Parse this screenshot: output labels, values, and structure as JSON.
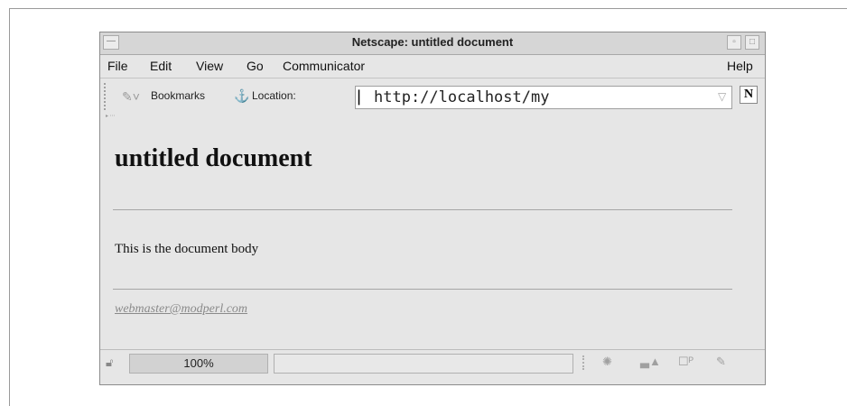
{
  "window": {
    "title": "Netscape: untitled document",
    "minimize_glyph": "—",
    "restore_glyph": "▫",
    "close_glyph": "□"
  },
  "menubar": {
    "items": [
      "File",
      "Edit",
      "View",
      "Go",
      "Communicator"
    ],
    "help": "Help"
  },
  "toolbar": {
    "bookmarks_label": "Bookmarks",
    "location_label": "Location:",
    "url": "http://localhost/my",
    "bookmarks_icon": "bookmark-icon",
    "location_icon": "location-icon",
    "logo_text": "N"
  },
  "document": {
    "heading": "untitled document",
    "body": "This is the document body",
    "email": "webmaster@modperl.com"
  },
  "statusbar": {
    "zoom": "100%"
  }
}
